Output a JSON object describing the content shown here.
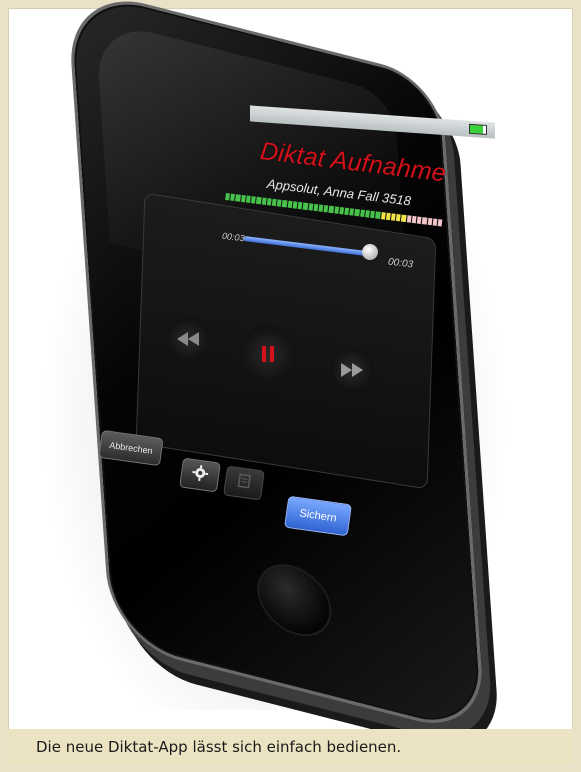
{
  "app": {
    "title": "Diktat Aufnahme",
    "subtitle": "Appsolut, Anna Fall 3518"
  },
  "player": {
    "time_elapsed": "00:03",
    "time_total": "00:03",
    "progress": 0.95
  },
  "level_meter": {
    "segments": 42,
    "active_green": 30,
    "active_yellow": 5,
    "rest_color": "#f1c4c9",
    "green": "#47c24a",
    "yellow": "#f2e34a"
  },
  "controls": {
    "rewind_icon": "rewind-icon",
    "pause_icon": "pause-icon",
    "forward_icon": "fast-forward-icon",
    "pause_color": "#d4101a"
  },
  "toolbar": {
    "cancel_label": "Abbrechen",
    "settings_icon": "gear-icon",
    "document_icon": "document-icon",
    "save_label": "Sichern",
    "save_color": "#2f63d2"
  },
  "caption": "Die neue Diktat-App lässt sich einfach bedienen."
}
